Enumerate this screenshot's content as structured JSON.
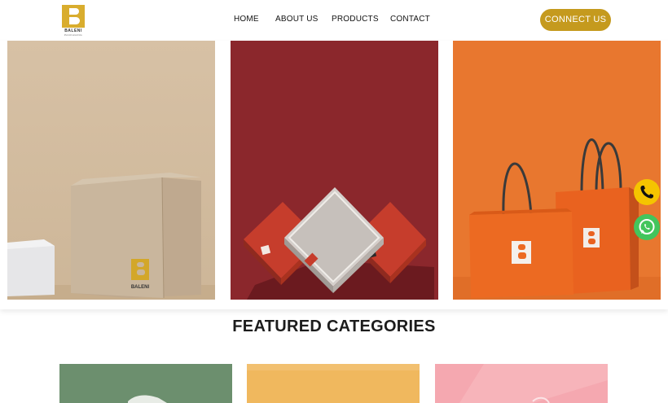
{
  "brand": {
    "name": "BALENI",
    "tagline": "PACKAGING"
  },
  "nav": {
    "items": [
      {
        "label": "HOME"
      },
      {
        "label": "ABOUT US"
      },
      {
        "label": "PRODUCTS"
      },
      {
        "label": "CONTACT"
      }
    ],
    "cta_label": "CONNECT US"
  },
  "hero": {
    "panels": [
      {
        "name": "beige-box-panel",
        "background": "#d8c3a7"
      },
      {
        "name": "red-boxes-panel",
        "background": "#8c282d"
      },
      {
        "name": "orange-bags-panel",
        "background": "#e8762f"
      }
    ],
    "logo_on_product": "BALENI"
  },
  "floating": {
    "phone_icon": "phone-icon",
    "whatsapp_icon": "whatsapp-icon",
    "phone_color": "#f5c400",
    "whatsapp_color": "#43c55c"
  },
  "featured": {
    "title": "FEATURED CATEGORIES",
    "categories": [
      {
        "color": "#6c8f6e"
      },
      {
        "color": "#f0b85e"
      },
      {
        "color": "#f5a8b0"
      }
    ]
  },
  "colors": {
    "accent": "#c59a1e"
  }
}
